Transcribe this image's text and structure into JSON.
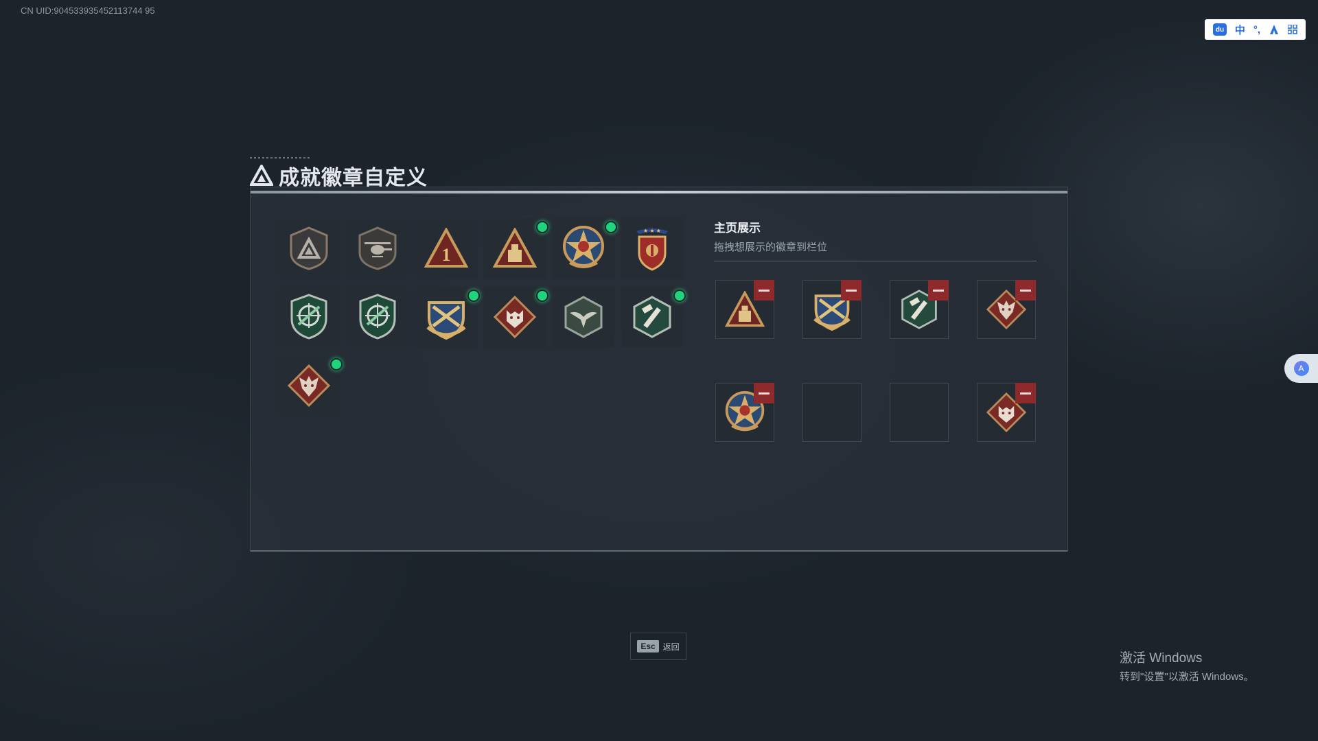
{
  "uid": "CN UID:904533935452113744 95",
  "ime": {
    "mode": "中",
    "punct": "°,",
    "icons": [
      "ime-logo-icon",
      "mode-chinese-icon",
      "punctuation-icon",
      "assistant-icon",
      "grid-menu-icon"
    ]
  },
  "title": "成就徽章自定义",
  "display": {
    "title": "主页展示",
    "subtitle": "拖拽想展示的徽章到栏位"
  },
  "badges": [
    {
      "icon": "triangle-shield-badge-icon",
      "new": false
    },
    {
      "icon": "helicopter-badge-icon",
      "new": false
    },
    {
      "icon": "number-one-triangle-badge-icon",
      "new": false
    },
    {
      "icon": "ammo-triangle-badge-icon",
      "new": true
    },
    {
      "icon": "star-medal-badge-icon",
      "new": true
    },
    {
      "icon": "shield-stars-badge-icon",
      "new": false
    },
    {
      "icon": "green-crosshair-rifle-badge-icon",
      "new": false
    },
    {
      "icon": "green-crosshair-rifle-2-badge-icon",
      "new": false
    },
    {
      "icon": "gold-crossed-rifles-badge-icon",
      "new": true
    },
    {
      "icon": "wolf-diamond-badge-icon",
      "new": true
    },
    {
      "icon": "eagle-hexagon-badge-icon",
      "new": false
    },
    {
      "icon": "green-hammer-hexagon-badge-icon",
      "new": true
    },
    {
      "icon": "dragon-diamond-badge-icon",
      "new": true
    }
  ],
  "slots": [
    {
      "icon": "ammo-triangle-badge-icon",
      "filled": true
    },
    {
      "icon": "gold-crossed-rifles-badge-icon",
      "filled": true
    },
    {
      "icon": "green-hammer-hexagon-badge-icon",
      "filled": true
    },
    {
      "icon": "dragon-diamond-badge-icon",
      "filled": true
    },
    {
      "icon": "star-medal-badge-icon",
      "filled": true
    },
    {
      "icon": "",
      "filled": false
    },
    {
      "icon": "",
      "filled": false
    },
    {
      "icon": "wolf-diamond-badge-icon",
      "filled": true
    }
  ],
  "esc": {
    "key": "Esc",
    "label": "返回"
  },
  "windows_activation": {
    "line1": "激活 Windows",
    "line2": "转到\"设置\"以激活 Windows。"
  },
  "colors": {
    "new_dot": "#1ed47c",
    "remove": "#8e2a2c",
    "panel": "#2a313a"
  }
}
